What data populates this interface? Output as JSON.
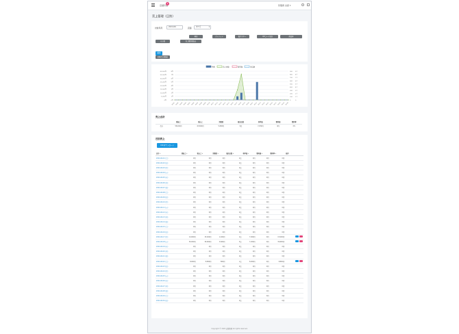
{
  "header": {
    "app_label": "店舗管理",
    "badge": "1",
    "user": "管理者 太郎 ▾"
  },
  "page_title": "売上管理（日別）",
  "filters": {
    "date_label": "対象年月",
    "date_value": "2024-06",
    "store_label": "店舗",
    "store_value": "すべて",
    "buttons": [
      "全体合計(税抜)",
      "現金",
      "クレジット",
      "電子マネー",
      "QRコード決済",
      "商品券",
      "その他",
      "売上種別(税込)"
    ],
    "submit": "検索"
  },
  "chart_data": {
    "type": "line",
    "legend": [
      "件数",
      "売上金額",
      "客単価",
      "来店数"
    ],
    "x": [
      "06/01",
      "06/02",
      "06/03",
      "06/04",
      "06/05",
      "06/06",
      "06/07",
      "06/08",
      "06/09",
      "06/10",
      "06/11",
      "06/12",
      "06/13",
      "06/14",
      "06/15",
      "06/16",
      "06/17",
      "06/18",
      "06/19",
      "06/20",
      "06/21",
      "06/22",
      "06/23",
      "06/24",
      "06/25",
      "06/26",
      "06/27",
      "06/28",
      "06/29",
      "06/30"
    ],
    "series": [
      {
        "name": "件数",
        "kind": "bar",
        "color": "#4a76a8",
        "values": [
          0,
          0,
          0,
          0,
          0,
          0,
          0,
          0,
          0,
          0,
          0,
          0,
          0,
          0,
          0,
          0,
          1,
          2,
          0,
          0,
          0,
          5,
          0,
          0,
          0,
          0,
          0,
          0,
          0,
          0
        ]
      },
      {
        "name": "売上金額",
        "kind": "area",
        "color": "#8dbf5b",
        "values": [
          0,
          0,
          0,
          0,
          0,
          0,
          0,
          0,
          0,
          0,
          0,
          0,
          0,
          0,
          0,
          0,
          14000,
          36000,
          0,
          0,
          0,
          0,
          0,
          0,
          0,
          0,
          0,
          0,
          0,
          0
        ]
      },
      {
        "name": "客単価",
        "kind": "line",
        "color": "#e06e8e",
        "values": [
          0,
          0,
          0,
          0,
          0,
          0,
          0,
          0,
          0,
          0,
          0,
          0,
          0,
          0,
          0,
          0,
          0,
          0,
          0,
          0,
          0,
          0,
          0,
          0,
          0,
          0,
          0,
          0,
          0,
          0
        ]
      },
      {
        "name": "来店数",
        "kind": "line",
        "color": "#6ab0de",
        "values": [
          0,
          0,
          0,
          0,
          0,
          0,
          0,
          0,
          0,
          0,
          0,
          0,
          0,
          0,
          0,
          0,
          0,
          0,
          0,
          0,
          0,
          0,
          0,
          0,
          0,
          0,
          0,
          0,
          0,
          0
        ]
      }
    ],
    "y_left_ticks": [
      "40,000円",
      "35,000円",
      "30,000円",
      "25,000円",
      "20,000円",
      "15,000円",
      "10,000円",
      "5,000円",
      "0円"
    ],
    "y_left_ticks2": [
      "8件",
      "7件",
      "6件",
      "5件",
      "4件",
      "3件",
      "2件",
      "1件",
      "0件"
    ],
    "y_right_ticks": [
      "900",
      "800",
      "700",
      "600",
      "500",
      "400",
      "300",
      "200",
      "100",
      "0"
    ],
    "y_right_ticks2": [
      "9人",
      "8人",
      "7人",
      "6人",
      "5人",
      "4人",
      "3人",
      "2人",
      "1人",
      "0"
    ],
    "ylim": [
      0,
      40000
    ]
  },
  "summary": {
    "title": "売上合計",
    "headers": [
      "",
      "税抜上",
      "税込上",
      "消費税",
      "販売点数",
      "客単価",
      "粗利額",
      "粗利率"
    ],
    "row": [
      "合計",
      "58,000円",
      "63,800円",
      "5,800円",
      "8点",
      "7,250円",
      "0円",
      "0%"
    ]
  },
  "daily": {
    "title": "日別売上",
    "export_button": "CSVダウンロード",
    "headers": [
      "日付 ▾",
      "税抜上 ▾",
      "税込上 ▾",
      "消費税 ▾",
      "販売点数 ▾",
      "客単価 ▾",
      "粗利額 ▾",
      "粗利率 ▾",
      "操作"
    ],
    "rows": [
      [
        "2024-06-01 (土)",
        "0円",
        "0円",
        "0円",
        "0点",
        "0円",
        "0円",
        "0円"
      ],
      [
        "2024-06-02 (日)",
        "0円",
        "0円",
        "0円",
        "0点",
        "0円",
        "0円",
        "0円"
      ],
      [
        "2024-06-03 (月)",
        "0円",
        "0円",
        "0円",
        "0点",
        "0円",
        "0円",
        "0円"
      ],
      [
        "2024-06-04 (火)",
        "0円",
        "0円",
        "0円",
        "0点",
        "0円",
        "0円",
        "0円"
      ],
      [
        "2024-06-05 (水)",
        "0円",
        "0円",
        "0円",
        "0点",
        "0円",
        "0円",
        "0円"
      ],
      [
        "2024-06-06 (木)",
        "0円",
        "0円",
        "0円",
        "0点",
        "0円",
        "0円",
        "0円"
      ],
      [
        "2024-06-07 (金)",
        "0円",
        "0円",
        "0円",
        "0点",
        "0円",
        "0円",
        "0円"
      ],
      [
        "2024-06-08 (土)",
        "0円",
        "0円",
        "0円",
        "0点",
        "0円",
        "0円",
        "0円"
      ],
      [
        "2024-06-09 (日)",
        "0円",
        "0円",
        "0円",
        "0点",
        "0円",
        "0円",
        "0円"
      ],
      [
        "2024-06-10 (月)",
        "0円",
        "0円",
        "0円",
        "0点",
        "0円",
        "0円",
        "0円"
      ],
      [
        "2024-06-11 (火)",
        "0円",
        "0円",
        "0円",
        "0点",
        "0円",
        "0円",
        "0円"
      ],
      [
        "2024-06-12 (水)",
        "0円",
        "0円",
        "0円",
        "0点",
        "0円",
        "0円",
        "0円"
      ],
      [
        "2024-06-13 (木)",
        "0円",
        "0円",
        "0円",
        "0点",
        "0円",
        "0円",
        "0円"
      ],
      [
        "2024-06-14 (金)",
        "0円",
        "0円",
        "0円",
        "0点",
        "0円",
        "0円",
        "0円"
      ],
      [
        "2024-06-15 (土)",
        "0円",
        "0円",
        "0円",
        "0点",
        "0円",
        "0円",
        "0円"
      ],
      [
        "2024-06-16 (日)",
        "0円",
        "0円",
        "0円",
        "0点",
        "0円",
        "0円",
        "0円"
      ],
      [
        "2024-06-17 (月)",
        "14,000円",
        "15,400円",
        "1,400円",
        "2点",
        "7,000円",
        "0円",
        "15,400円"
      ],
      [
        "2024-06-18 (火)",
        "36,000円",
        "39,600円",
        "3,600円",
        "5点",
        "7,200円",
        "0円",
        "39,600円"
      ],
      [
        "2024-06-19 (水)",
        "0円",
        "0円",
        "0円",
        "0点",
        "0円",
        "0円",
        "0円"
      ],
      [
        "2024-06-20 (木)",
        "0円",
        "0円",
        "0円",
        "0点",
        "0円",
        "0円",
        "0円"
      ],
      [
        "2024-06-21 (金)",
        "0円",
        "0円",
        "0円",
        "0点",
        "0円",
        "0円",
        "0円"
      ],
      [
        "2024-06-22 (土)",
        "8,000円",
        "8,800円",
        "800円",
        "1点",
        "8,000円",
        "0円",
        "8,800円"
      ],
      [
        "2024-06-23 (日)",
        "0円",
        "0円",
        "0円",
        "0点",
        "0円",
        "0円",
        "0円"
      ],
      [
        "2024-06-24 (月)",
        "0円",
        "0円",
        "0円",
        "0点",
        "0円",
        "0円",
        "0円"
      ],
      [
        "2024-06-25 (火)",
        "0円",
        "0円",
        "0円",
        "0点",
        "0円",
        "0円",
        "0円"
      ],
      [
        "2024-06-26 (水)",
        "0円",
        "0円",
        "0円",
        "0点",
        "0円",
        "0円",
        "0円"
      ],
      [
        "2024-06-27 (木)",
        "0円",
        "0円",
        "0円",
        "0点",
        "0円",
        "0円",
        "0円"
      ],
      [
        "2024-06-28 (金)",
        "0円",
        "0円",
        "0円",
        "0点",
        "0円",
        "0円",
        "0円"
      ],
      [
        "2024-06-29 (土)",
        "0円",
        "0円",
        "0円",
        "0点",
        "0円",
        "0円",
        "0円"
      ],
      [
        "2024-06-30 (日)",
        "0円",
        "0円",
        "0円",
        "0点",
        "0円",
        "0円",
        "0円"
      ]
    ],
    "action_rows": [
      16,
      17,
      21
    ],
    "action_colors": [
      "#1997e0",
      "#e2457a"
    ]
  },
  "footer": "Copyright © 2024 店舗管理 All rights reserved."
}
